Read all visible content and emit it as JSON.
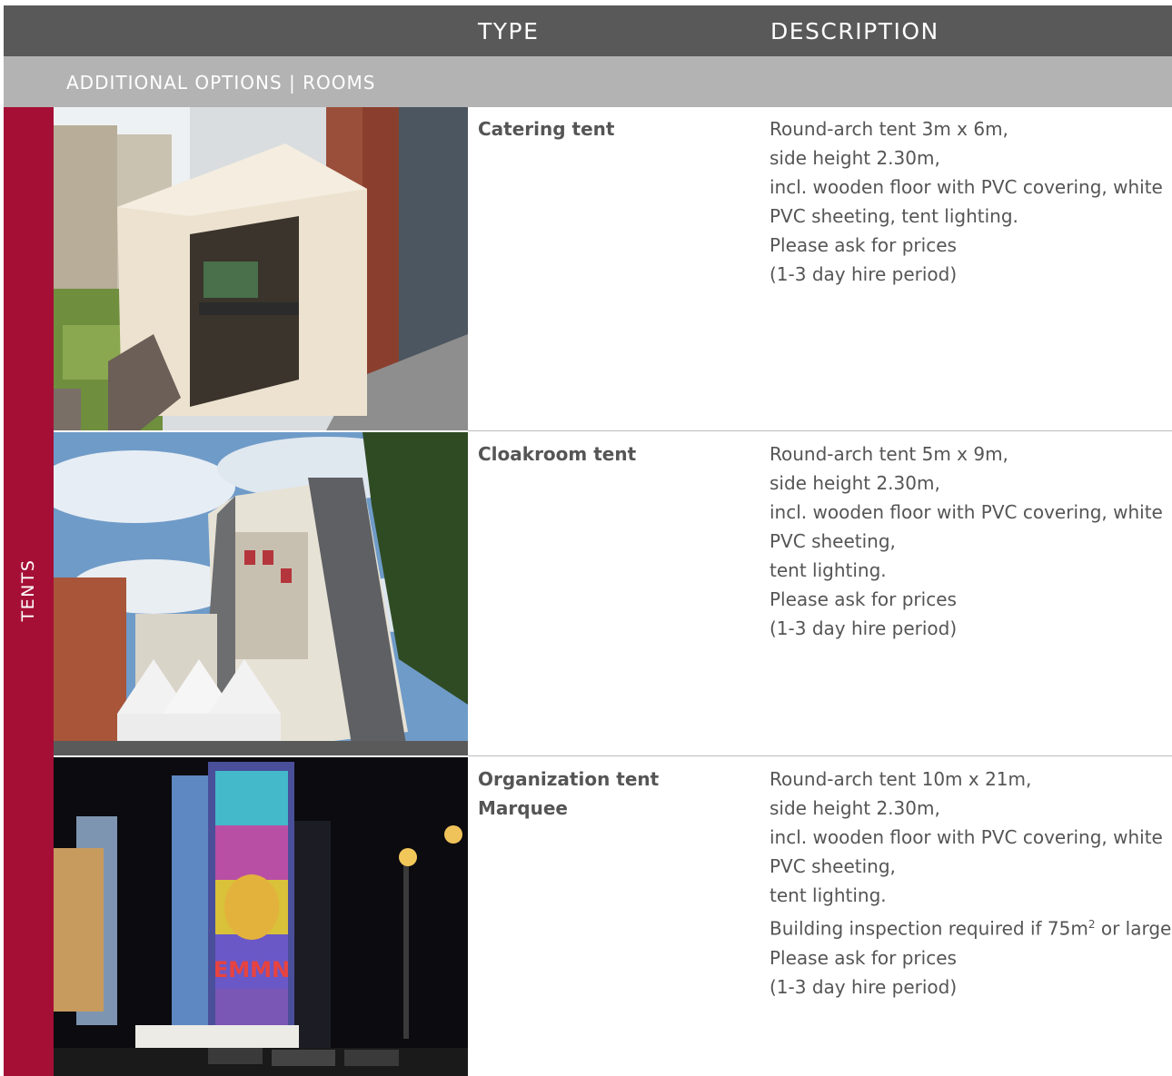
{
  "header": {
    "type_label": "TYPE",
    "description_label": "DESCRIPTION"
  },
  "section": {
    "title": "ADDITIONAL OPTIONS | ROOMS"
  },
  "side_tab": {
    "label": "TENTS"
  },
  "colors": {
    "header_bg": "#595959",
    "section_bg": "#b3b3b3",
    "accent": "#a50f36",
    "text": "#555555"
  },
  "rows": [
    {
      "type_lines": [
        "Catering tent"
      ],
      "description_lines": [
        "Round-arch tent 3m x 6m,",
        "side height 2.30m,",
        "incl. wooden floor with PVC covering, white",
        "PVC sheeting, tent lighting.",
        "Please ask for prices",
        "(1-3 day hire period)"
      ]
    },
    {
      "type_lines": [
        "Cloakroom tent"
      ],
      "description_lines": [
        "Round-arch tent 5m x 9m,",
        "side height 2.30m,",
        "incl. wooden floor with PVC covering, white",
        "PVC sheeting,",
        "tent lighting.",
        "Please ask for prices",
        "(1-3 day hire period)"
      ]
    },
    {
      "type_lines": [
        "Organization tent",
        "Marquee"
      ],
      "description_lines": [
        "Round-arch tent 10m x 21m,",
        "side height 2.30m,",
        "incl. wooden floor with PVC covering, white",
        "PVC sheeting,",
        "tent lighting.",
        "Building inspection required if 75m",
        "Please ask for prices",
        "(1-3 day hire period)"
      ],
      "inspection_superscript": "2",
      "inspection_suffix": " or larger",
      "photo_sign": "EMMN"
    }
  ]
}
